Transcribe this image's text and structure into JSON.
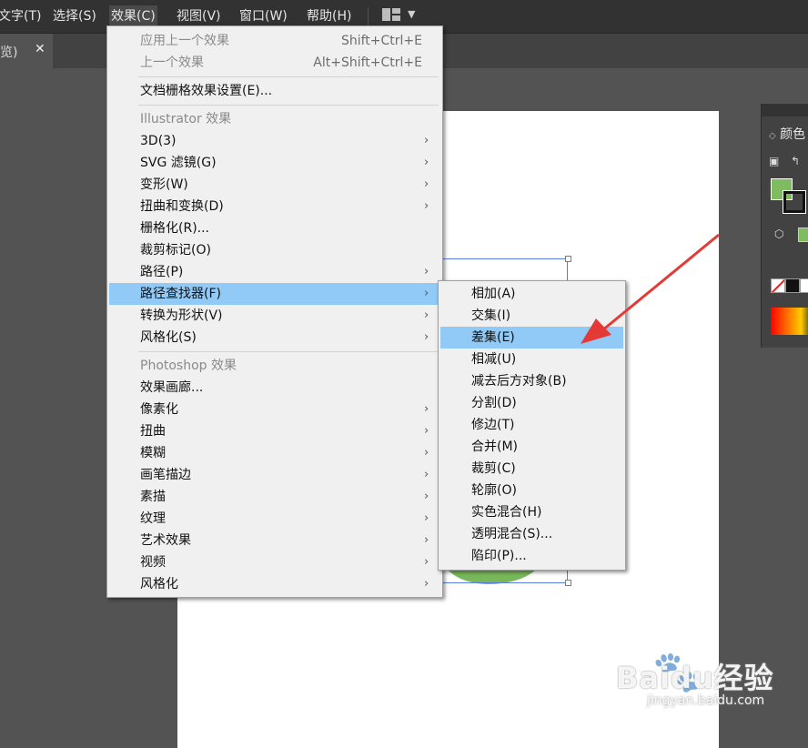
{
  "menubar": {
    "items": [
      {
        "label": "文字(T)"
      },
      {
        "label": "选择(S)"
      },
      {
        "label": "效果(C)"
      },
      {
        "label": "视图(V)"
      },
      {
        "label": "窗口(W)"
      },
      {
        "label": "帮助(H)"
      }
    ]
  },
  "document_tab": {
    "label": "览)",
    "close_symbol": "✕"
  },
  "effect_menu": {
    "apply_last": {
      "label": "应用上一个效果",
      "shortcut": "Shift+Ctrl+E"
    },
    "last": {
      "label": "上一个效果",
      "shortcut": "Alt+Shift+Ctrl+E"
    },
    "raster_settings": {
      "label": "文档栅格效果设置(E)..."
    },
    "illustrator_header": "Illustrator 效果",
    "illustrator_items": [
      {
        "label": "3D(3)",
        "submenu": true
      },
      {
        "label": "SVG 滤镜(G)",
        "submenu": true
      },
      {
        "label": "变形(W)",
        "submenu": true
      },
      {
        "label": "扭曲和变换(D)",
        "submenu": true
      },
      {
        "label": "栅格化(R)...",
        "submenu": false
      },
      {
        "label": "裁剪标记(O)",
        "submenu": false
      },
      {
        "label": "路径(P)",
        "submenu": true
      },
      {
        "label": "路径查找器(F)",
        "submenu": true,
        "highlighted": true
      },
      {
        "label": "转换为形状(V)",
        "submenu": true
      },
      {
        "label": "风格化(S)",
        "submenu": true
      }
    ],
    "photoshop_header": "Photoshop 效果",
    "photoshop_items": [
      {
        "label": "效果画廊...",
        "submenu": false
      },
      {
        "label": "像素化",
        "submenu": true
      },
      {
        "label": "扭曲",
        "submenu": true
      },
      {
        "label": "模糊",
        "submenu": true
      },
      {
        "label": "画笔描边",
        "submenu": true
      },
      {
        "label": "素描",
        "submenu": true
      },
      {
        "label": "纹理",
        "submenu": true
      },
      {
        "label": "艺术效果",
        "submenu": true
      },
      {
        "label": "视频",
        "submenu": true
      },
      {
        "label": "风格化",
        "submenu": true
      }
    ],
    "submenu_arrow": "›"
  },
  "pathfinder_submenu": {
    "items": [
      {
        "label": "相加(A)"
      },
      {
        "label": "交集(I)"
      },
      {
        "label": "差集(E)",
        "highlighted": true
      },
      {
        "label": "相减(U)"
      },
      {
        "label": "减去后方对象(B)"
      },
      {
        "label": "分割(D)"
      },
      {
        "label": "修边(T)"
      },
      {
        "label": "合并(M)"
      },
      {
        "label": "裁剪(C)"
      },
      {
        "label": "轮廓(O)"
      },
      {
        "label": "实色混合(H)"
      },
      {
        "label": "透明混合(S)..."
      },
      {
        "label": "陷印(P)..."
      }
    ]
  },
  "color_panel": {
    "title": "颜色",
    "collapse_symbol": "◇",
    "fill_color": "#7fbb5f"
  },
  "colors": {
    "menubar_bg": "#323232",
    "menu_bg": "#f0f0f0",
    "highlight": "#91c9f7",
    "annotation_arrow": "#e53935",
    "shape_fill": "#79b85a",
    "selection": "#5a7cdc"
  },
  "watermark": {
    "main": "Baidu经验",
    "sub": "jingyan.baidu.com"
  }
}
